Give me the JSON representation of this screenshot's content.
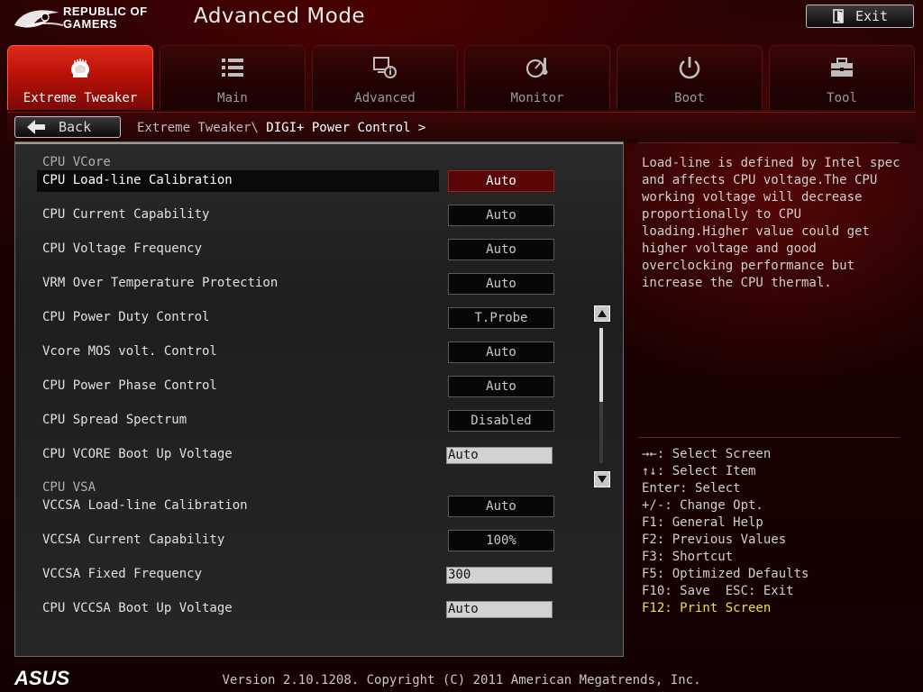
{
  "header": {
    "brand_line1": "REPUBLIC OF",
    "brand_line2": "GAMERS",
    "mode_title": "Advanced Mode",
    "exit_label": "Exit"
  },
  "tabs": [
    {
      "label": "Extreme Tweaker",
      "icon": "tweaker-icon",
      "active": true
    },
    {
      "label": "Main",
      "icon": "list-icon",
      "active": false
    },
    {
      "label": "Advanced",
      "icon": "advanced-icon",
      "active": false
    },
    {
      "label": "Monitor",
      "icon": "monitor-icon",
      "active": false
    },
    {
      "label": "Boot",
      "icon": "power-icon",
      "active": false
    },
    {
      "label": "Tool",
      "icon": "toolbox-icon",
      "active": false
    }
  ],
  "nav": {
    "back_label": "Back",
    "breadcrumb_path": "Extreme Tweaker\\",
    "breadcrumb_current": "DIGI+ Power Control >"
  },
  "settings": {
    "section_vcore": "CPU VCore",
    "section_vsa": "CPU VSA",
    "rows": [
      {
        "label": "CPU Load-line Calibration",
        "value": "Auto"
      },
      {
        "label": "CPU Current Capability",
        "value": "Auto"
      },
      {
        "label": "CPU Voltage Frequency",
        "value": "Auto"
      },
      {
        "label": "VRM Over Temperature Protection",
        "value": "Auto"
      },
      {
        "label": "CPU Power Duty Control",
        "value": "T.Probe"
      },
      {
        "label": "Vcore MOS volt. Control",
        "value": "Auto"
      },
      {
        "label": "CPU Power Phase Control",
        "value": "Auto"
      },
      {
        "label": "CPU Spread Spectrum",
        "value": "Disabled"
      },
      {
        "label": "CPU VCORE Boot Up Voltage",
        "value": "Auto"
      },
      {
        "label": "VCCSA Load-line Calibration",
        "value": "Auto"
      },
      {
        "label": "VCCSA Current Capability",
        "value": "100%"
      },
      {
        "label": "VCCSA Fixed Frequency",
        "value": "300"
      },
      {
        "label": "CPU VCCSA Boot Up Voltage",
        "value": "Auto"
      }
    ]
  },
  "help": {
    "description": "Load-line is defined by Intel spec and affects CPU voltage.The CPU working voltage will decrease proportionally to CPU loading.Higher value could get higher voltage and good overclocking performance but increase the CPU thermal.",
    "keys": [
      "→←: Select Screen",
      "↑↓: Select Item",
      "Enter: Select",
      "+/-: Change Opt.",
      "F1: General Help",
      "F2: Previous Values",
      "F3: Shortcut",
      "F5: Optimized Defaults",
      "F10: Save  ESC: Exit"
    ],
    "highlight_key": "F12: Print Screen"
  },
  "footer": {
    "brand": "ASUS",
    "version": "Version 2.10.1208. Copyright (C) 2011 American Megatrends, Inc."
  },
  "colors": {
    "accent_red": "#b81208",
    "selected_value_bg": "#5a0606",
    "highlight_yellow": "#f0e23a"
  }
}
